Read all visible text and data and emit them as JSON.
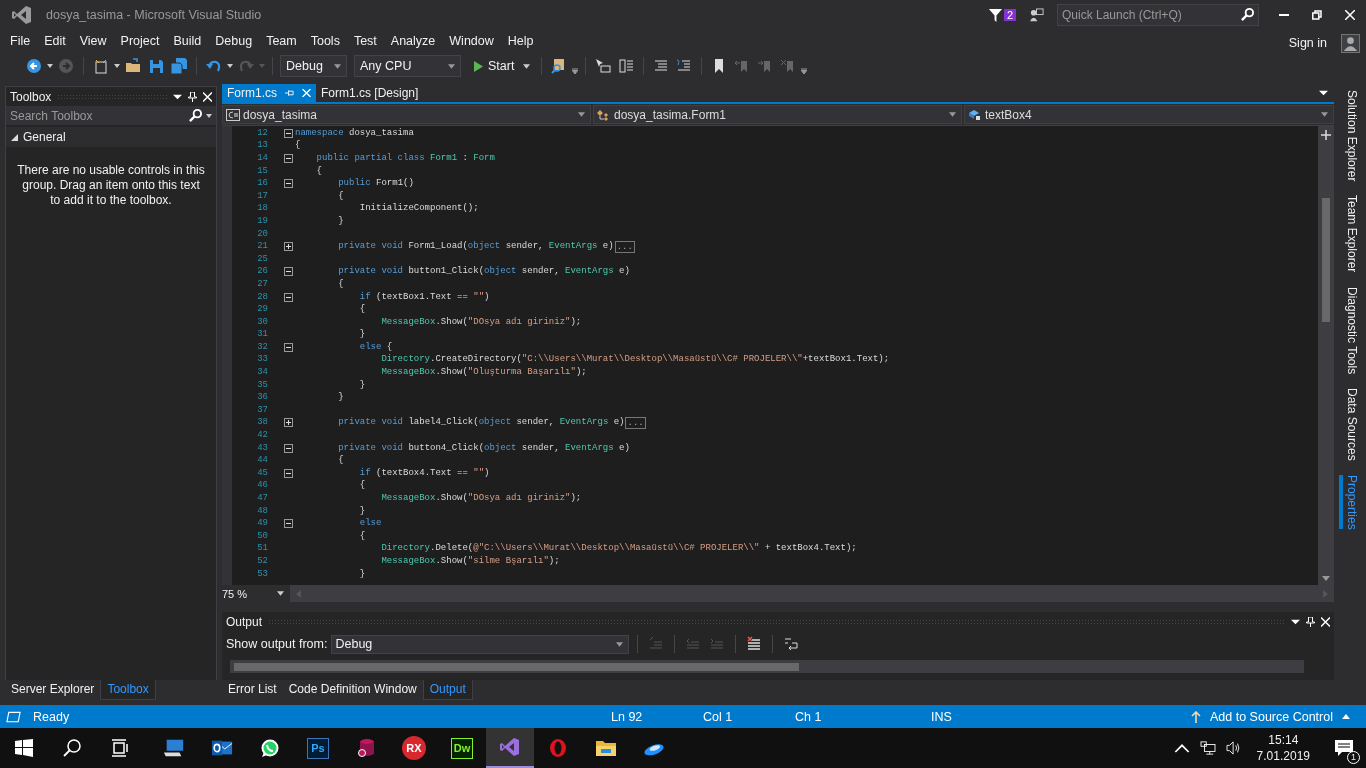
{
  "window": {
    "title": "dosya_tasima - Microsoft Visual Studio",
    "notification_count": "2",
    "quick_launch": {
      "placeholder": "Quick Launch (Ctrl+Q)"
    }
  },
  "menu": [
    "File",
    "Edit",
    "View",
    "Project",
    "Build",
    "Debug",
    "Team",
    "Tools",
    "Test",
    "Analyze",
    "Window",
    "Help"
  ],
  "account": {
    "label": "Sign in"
  },
  "toolbar": {
    "configuration": "Debug",
    "platform": "Any CPU",
    "start": "Start"
  },
  "toolbox": {
    "title": "Toolbox",
    "search": {
      "placeholder": "Search Toolbox"
    },
    "group": {
      "label": "General",
      "expanded": true
    },
    "message": "There are no usable controls in this group. Drag an item onto this text to add it to the toolbox.",
    "tabs": [
      {
        "label": "Server Explorer",
        "selected": false
      },
      {
        "label": "Toolbox",
        "selected": true
      }
    ]
  },
  "editor": {
    "tabs": [
      {
        "label": "Form1.cs",
        "selected": true
      },
      {
        "label": "Form1.cs [Design]",
        "selected": false
      }
    ],
    "navigation": [
      {
        "kind": "project",
        "text": "dosya_tasima"
      },
      {
        "kind": "class",
        "text": "dosya_tasima.Form1"
      },
      {
        "kind": "field",
        "text": "textBox4"
      }
    ],
    "lines": [
      {
        "number": "12",
        "expanded": true,
        "tokens": [
          {
            "kind": "kw",
            "text": "namespace"
          },
          {
            "kind": "plain",
            "text": " dosya_tasima"
          }
        ]
      },
      {
        "number": "13",
        "tokens": [
          {
            "kind": "plain",
            "text": "{"
          }
        ]
      },
      {
        "number": "14",
        "expanded": true,
        "tokens": [
          {
            "kind": "kw",
            "text": "    public partial class "
          },
          {
            "kind": "type",
            "text": "Form1"
          },
          {
            "kind": "plain",
            "text": " : "
          },
          {
            "kind": "type",
            "text": "Form"
          }
        ]
      },
      {
        "number": "15",
        "tokens": [
          {
            "kind": "plain",
            "text": "    {"
          }
        ]
      },
      {
        "number": "16",
        "expanded": true,
        "tokens": [
          {
            "kind": "kw",
            "text": "        public"
          },
          {
            "kind": "plain",
            "text": " Form1()"
          }
        ]
      },
      {
        "number": "17",
        "tokens": [
          {
            "kind": "plain",
            "text": "        {"
          }
        ]
      },
      {
        "number": "18",
        "tokens": [
          {
            "kind": "plain",
            "text": "            InitializeComponent();"
          }
        ]
      },
      {
        "number": "19",
        "tokens": [
          {
            "kind": "plain",
            "text": "        }"
          }
        ]
      },
      {
        "number": "20"
      },
      {
        "number": "21",
        "expanded": false,
        "collapsed": "...",
        "tokens": [
          {
            "kind": "kw",
            "text": "        private void"
          },
          {
            "kind": "plain",
            "text": " Form1_Load("
          },
          {
            "kind": "kw",
            "text": "object"
          },
          {
            "kind": "plain",
            "text": " sender, "
          },
          {
            "kind": "type",
            "text": "EventArgs"
          },
          {
            "kind": "plain",
            "text": " e)"
          }
        ]
      },
      {
        "number": "25"
      },
      {
        "number": "26",
        "expanded": true,
        "tokens": [
          {
            "kind": "kw",
            "text": "        private void"
          },
          {
            "kind": "plain",
            "text": " button1_Click("
          },
          {
            "kind": "kw",
            "text": "object"
          },
          {
            "kind": "plain",
            "text": " sender, "
          },
          {
            "kind": "type",
            "text": "EventArgs"
          },
          {
            "kind": "plain",
            "text": " e)"
          }
        ]
      },
      {
        "number": "27",
        "tokens": [
          {
            "kind": "plain",
            "text": "        {"
          }
        ]
      },
      {
        "number": "28",
        "expanded": true,
        "tokens": [
          {
            "kind": "kw",
            "text": "            if"
          },
          {
            "kind": "plain",
            "text": " (textBox1.Text == "
          },
          {
            "kind": "str",
            "text": "\"\""
          },
          {
            "kind": "plain",
            "text": ")"
          }
        ]
      },
      {
        "number": "29",
        "tokens": [
          {
            "kind": "plain",
            "text": "            {"
          }
        ]
      },
      {
        "number": "30",
        "tokens": [
          {
            "kind": "type",
            "text": "                MessageBox"
          },
          {
            "kind": "plain",
            "text": ".Show("
          },
          {
            "kind": "str",
            "text": "\"DOsya adı giriniz\""
          },
          {
            "kind": "plain",
            "text": ");"
          }
        ]
      },
      {
        "number": "31",
        "tokens": [
          {
            "kind": "plain",
            "text": "            }"
          }
        ]
      },
      {
        "number": "32",
        "expanded": true,
        "tokens": [
          {
            "kind": "kw",
            "text": "            else"
          },
          {
            "kind": "plain",
            "text": " {"
          }
        ]
      },
      {
        "number": "33",
        "tokens": [
          {
            "kind": "type",
            "text": "                Directory"
          },
          {
            "kind": "plain",
            "text": ".CreateDirectory("
          },
          {
            "kind": "str",
            "text": "\"C:\\\\Users\\\\Murat\\\\Desktop\\\\Masaüstü\\\\C# PROJELER\\\\\""
          },
          {
            "kind": "plain",
            "text": "+textBox1.Text);"
          }
        ]
      },
      {
        "number": "34",
        "tokens": [
          {
            "kind": "type",
            "text": "                MessageBox"
          },
          {
            "kind": "plain",
            "text": ".Show("
          },
          {
            "kind": "str",
            "text": "\"Oluşturma Başarılı\""
          },
          {
            "kind": "plain",
            "text": ");"
          }
        ]
      },
      {
        "number": "35",
        "tokens": [
          {
            "kind": "plain",
            "text": "            }"
          }
        ]
      },
      {
        "number": "36",
        "tokens": [
          {
            "kind": "plain",
            "text": "        }"
          }
        ]
      },
      {
        "number": "37"
      },
      {
        "number": "38",
        "expanded": false,
        "collapsed": "...",
        "tokens": [
          {
            "kind": "kw",
            "text": "        private void"
          },
          {
            "kind": "plain",
            "text": " label4_Click("
          },
          {
            "kind": "kw",
            "text": "object"
          },
          {
            "kind": "plain",
            "text": " sender, "
          },
          {
            "kind": "type",
            "text": "EventArgs"
          },
          {
            "kind": "plain",
            "text": " e)"
          }
        ]
      },
      {
        "number": "42"
      },
      {
        "number": "43",
        "expanded": true,
        "tokens": [
          {
            "kind": "kw",
            "text": "        private void"
          },
          {
            "kind": "plain",
            "text": " button4_Click("
          },
          {
            "kind": "kw",
            "text": "object"
          },
          {
            "kind": "plain",
            "text": " sender, "
          },
          {
            "kind": "type",
            "text": "EventArgs"
          },
          {
            "kind": "plain",
            "text": " e)"
          }
        ]
      },
      {
        "number": "44",
        "tokens": [
          {
            "kind": "plain",
            "text": "        {"
          }
        ]
      },
      {
        "number": "45",
        "expanded": true,
        "tokens": [
          {
            "kind": "kw",
            "text": "            if"
          },
          {
            "kind": "plain",
            "text": " (textBox4.Text == "
          },
          {
            "kind": "str",
            "text": "\"\""
          },
          {
            "kind": "plain",
            "text": ")"
          }
        ]
      },
      {
        "number": "46",
        "tokens": [
          {
            "kind": "plain",
            "text": "            {"
          }
        ]
      },
      {
        "number": "47",
        "tokens": [
          {
            "kind": "type",
            "text": "                MessageBox"
          },
          {
            "kind": "plain",
            "text": ".Show("
          },
          {
            "kind": "str",
            "text": "\"DOsya adı giriniz\""
          },
          {
            "kind": "plain",
            "text": ");"
          }
        ]
      },
      {
        "number": "48",
        "tokens": [
          {
            "kind": "plain",
            "text": "            }"
          }
        ]
      },
      {
        "number": "49",
        "expanded": true,
        "tokens": [
          {
            "kind": "kw",
            "text": "            else"
          }
        ]
      },
      {
        "number": "50",
        "tokens": [
          {
            "kind": "plain",
            "text": "            {"
          }
        ]
      },
      {
        "number": "51",
        "tokens": [
          {
            "kind": "type",
            "text": "                Directory"
          },
          {
            "kind": "plain",
            "text": ".Delete("
          },
          {
            "kind": "str",
            "text": "@\"C:\\\\Users\\\\Murat\\\\Desktop\\\\Masaüstü\\\\C# PROJELER\\\\\""
          },
          {
            "kind": "plain",
            "text": " + textBox4.Text);"
          }
        ]
      },
      {
        "number": "52",
        "tokens": [
          {
            "kind": "type",
            "text": "                MessageBox"
          },
          {
            "kind": "plain",
            "text": ".Show("
          },
          {
            "kind": "str",
            "text": "\"silme Bşarılı\""
          },
          {
            "kind": "plain",
            "text": ");"
          }
        ]
      },
      {
        "number": "53",
        "tokens": [
          {
            "kind": "plain",
            "text": "            }"
          }
        ]
      }
    ],
    "zoom": "75 %"
  },
  "output": {
    "title": "Output",
    "source_label": "Show output from:",
    "source": "Debug"
  },
  "bottom_tabs": [
    {
      "label": "Error List",
      "selected": false
    },
    {
      "label": "Code Definition Window",
      "selected": false
    },
    {
      "label": "Output",
      "selected": true
    }
  ],
  "side_tabs": [
    {
      "label": "Solution Explorer",
      "selected": false
    },
    {
      "label": "Team Explorer",
      "selected": false
    },
    {
      "label": "Diagnostic Tools",
      "selected": false
    },
    {
      "label": "Data Sources",
      "selected": false
    },
    {
      "label": "Properties",
      "selected": true
    }
  ],
  "status_bar": {
    "message": "Ready",
    "line": "Ln 92",
    "column": "Col 1",
    "char": "Ch 1",
    "mode": "INS",
    "source_control": "Add to Source Control"
  },
  "taskbar": {
    "apps": [
      {
        "kind": "start",
        "selected": false
      },
      {
        "kind": "search",
        "selected": false
      },
      {
        "kind": "task-view",
        "selected": false
      },
      {
        "kind": "computer",
        "selected": false
      },
      {
        "kind": "mail",
        "selected": false
      },
      {
        "kind": "chat",
        "selected": false
      },
      {
        "kind": "badge",
        "label": "Ps",
        "color": "#001d34",
        "selected": false
      },
      {
        "kind": "database",
        "selected": false
      },
      {
        "kind": "round-badge",
        "label": "RX",
        "color": "#d7282f",
        "selected": false
      },
      {
        "kind": "badge",
        "label": "Dw",
        "color": "#072401",
        "selected": false
      },
      {
        "kind": "ide",
        "selected": true
      },
      {
        "kind": "ring",
        "selected": false
      },
      {
        "kind": "folder",
        "selected": false
      },
      {
        "kind": "disc",
        "selected": false
      }
    ],
    "time": "15:14",
    "date": "7.01.2019",
    "notification_count": "1"
  }
}
